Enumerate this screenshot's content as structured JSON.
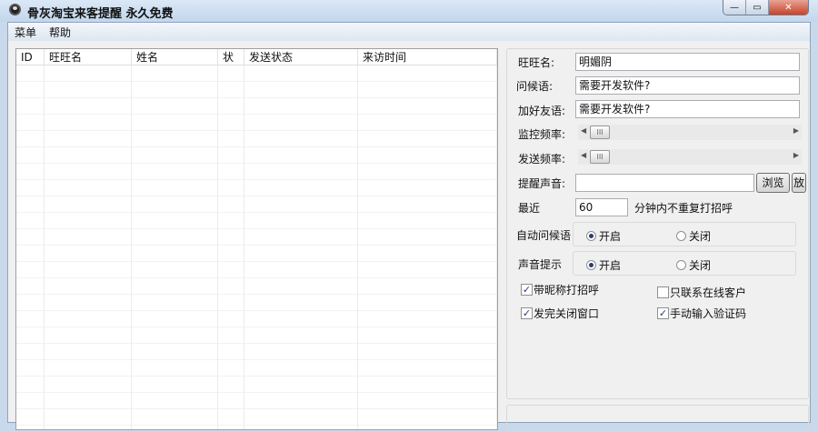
{
  "window": {
    "title": "骨灰淘宝来客提醒  永久免费",
    "close": "✕"
  },
  "menu": [
    "菜单",
    "帮助"
  ],
  "table": {
    "columns": [
      "ID",
      "旺旺名",
      "姓名",
      "状",
      "发送状态",
      "来访时间"
    ]
  },
  "form": {
    "wangwang_label": "旺旺名:",
    "wangwang_value": "明媚阴",
    "greeting_label": "问候语:",
    "greeting_value": "需要开发软件?",
    "addfriend_label": "加好友语:",
    "addfriend_value": "需要开发软件?",
    "monitor_freq_label": "监控频率:",
    "send_freq_label": "发送频率:",
    "sound_label": "提醒声音:",
    "sound_value": "",
    "browse": "浏览",
    "play": "放",
    "recent_label": "最近",
    "recent_value": "60",
    "recent_suffix": "分钟内不重复打招呼",
    "auto_greet_label": "自动问候语",
    "sound_tip_label": "声音提示",
    "on": "开启",
    "off": "关闭",
    "checks": [
      {
        "label": "带昵称打招呼",
        "checked": true
      },
      {
        "label": "只联系在线客户",
        "checked": false
      },
      {
        "label": "发完关闭窗口",
        "checked": true
      },
      {
        "label": "手动输入验证码",
        "checked": true
      }
    ]
  }
}
